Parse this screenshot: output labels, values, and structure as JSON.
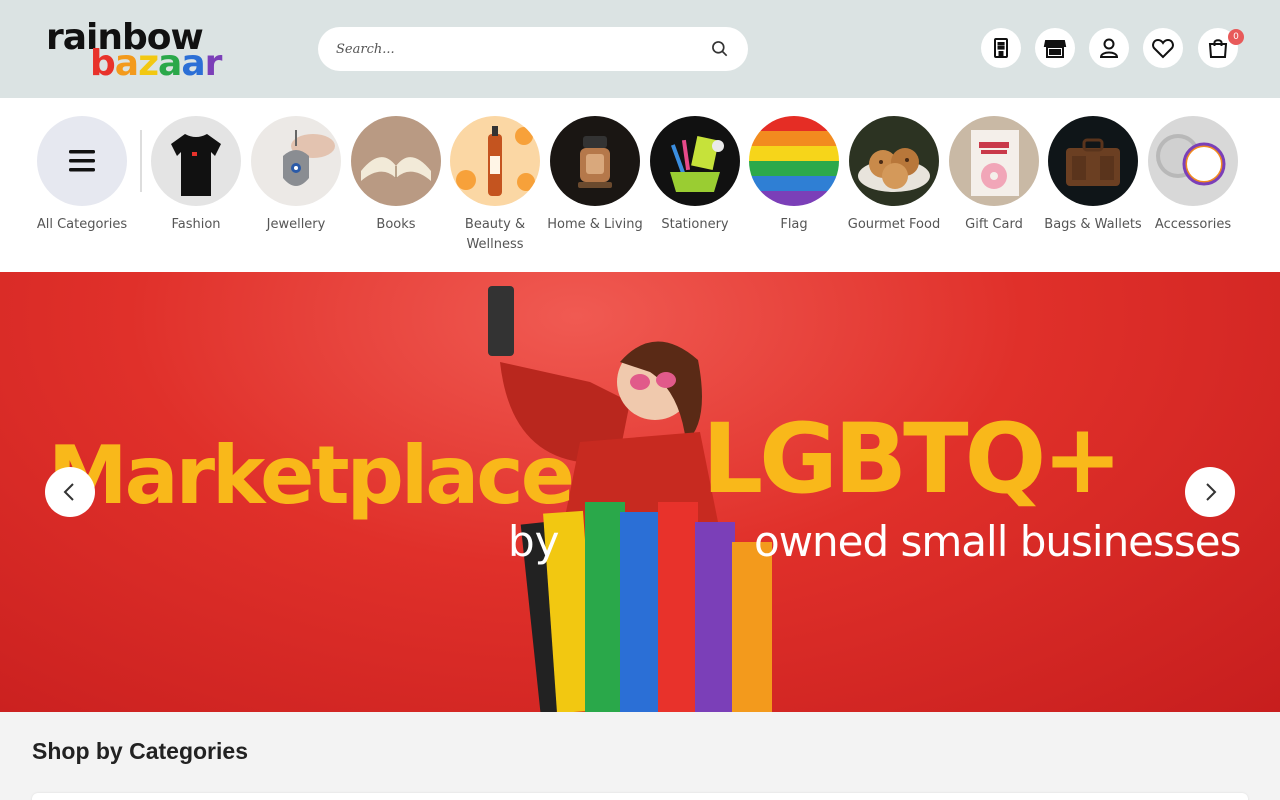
{
  "header": {
    "logo_line1": "rainbow",
    "logo_line2": [
      "b",
      "a",
      "z",
      "a",
      "a",
      "r"
    ],
    "search_placeholder": "Search...",
    "cart_count": "0",
    "icons": [
      "building-icon",
      "store-icon",
      "user-icon",
      "heart-icon",
      "shopping-bag-icon"
    ]
  },
  "categories": [
    {
      "label": "All Categories",
      "icon": "menu-icon"
    },
    {
      "label": "Fashion"
    },
    {
      "label": "Jewellery"
    },
    {
      "label": "Books"
    },
    {
      "label": "Beauty & Wellness"
    },
    {
      "label": "Home & Living"
    },
    {
      "label": "Stationery"
    },
    {
      "label": "Flag"
    },
    {
      "label": "Gourmet Food"
    },
    {
      "label": "Gift Card"
    },
    {
      "label": "Bags & Wallets"
    },
    {
      "label": "Accessories"
    }
  ],
  "banner": {
    "headline_left": "Marketplace",
    "headline_right": "LGBTQ+",
    "sub_left": "by",
    "sub_right": "owned small businesses"
  },
  "section": {
    "title": "Shop by Categories"
  },
  "colors": {
    "header_bg": "#dbe3e3",
    "banner_red": "#e0302a",
    "banner_yellow": "#f9b81a",
    "badge": "#e85a5a"
  }
}
